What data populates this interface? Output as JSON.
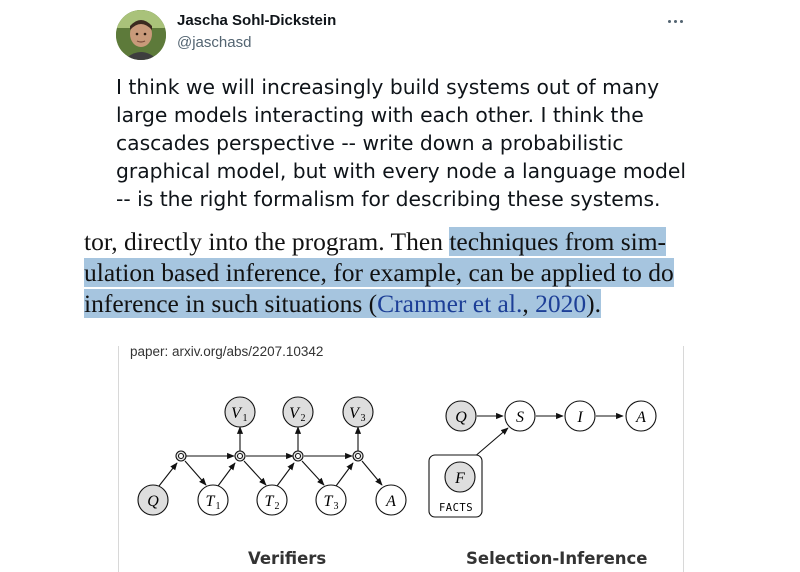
{
  "tweet": {
    "author_name": "Jascha Sohl-Dickstein",
    "author_handle": "@jaschasd",
    "avatar_icon": "avatar",
    "more_icon": "more-options-icon",
    "lines": [
      "I think we will increasingly build systems out of many",
      "large models interacting with each other. I think the",
      "cascades perspective -- write down a probabilistic",
      "graphical model, but with every node a language model",
      "-- is the right formalism for describing these systems."
    ]
  },
  "excerpt": {
    "line1_plain": "tor, directly into the program.  Then ",
    "line1_hl": "techniques from sim-",
    "line2_hl": "ulation based inference, for example, can be applied to do",
    "line3_hl_a": "inference in such situations (",
    "cite_authors": "Cranmer et al.",
    "cite_comma": ", ",
    "cite_year": "2020",
    "line3_hl_b": ").",
    "highlight_color": "#a6c5df",
    "cite_color": "#1d3f97"
  },
  "figure": {
    "paper_link": "paper: arxiv.org/abs/2207.10342",
    "verifiers": {
      "caption": "Verifiers",
      "nodes": {
        "q": "Q",
        "t1": "T",
        "t1_sub": "1",
        "t2": "T",
        "t2_sub": "2",
        "t3": "T",
        "t3_sub": "3",
        "a": "A",
        "v1": "V",
        "v1_sub": "1",
        "v2": "V",
        "v2_sub": "2",
        "v3": "V",
        "v3_sub": "3"
      }
    },
    "selection_inference": {
      "caption": "Selection-Inference",
      "nodes": {
        "q": "Q",
        "s": "S",
        "i": "I",
        "a": "A",
        "f": "F",
        "facts_label": "FACTS"
      }
    }
  }
}
